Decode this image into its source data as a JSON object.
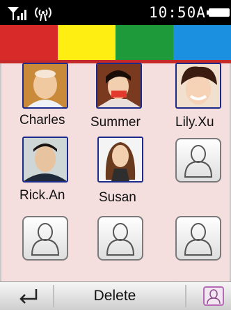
{
  "statusbar": {
    "time": "10:50A"
  },
  "tabs": [
    {
      "color": "#d92a2a"
    },
    {
      "color": "#ffee11"
    },
    {
      "color": "#1e9a3a"
    },
    {
      "color": "#1b8fe0"
    }
  ],
  "contacts": [
    {
      "name": "Charles",
      "has_photo": true
    },
    {
      "name": "Summer",
      "has_photo": true
    },
    {
      "name": "Lily.Xu",
      "has_photo": true
    },
    {
      "name": "Rick.An",
      "has_photo": true
    },
    {
      "name": "Susan",
      "has_photo": true
    },
    {
      "name": "",
      "has_photo": false
    },
    {
      "name": "",
      "has_photo": false
    },
    {
      "name": "",
      "has_photo": false
    },
    {
      "name": "",
      "has_photo": false
    }
  ],
  "bottombar": {
    "delete_label": "Delete"
  }
}
